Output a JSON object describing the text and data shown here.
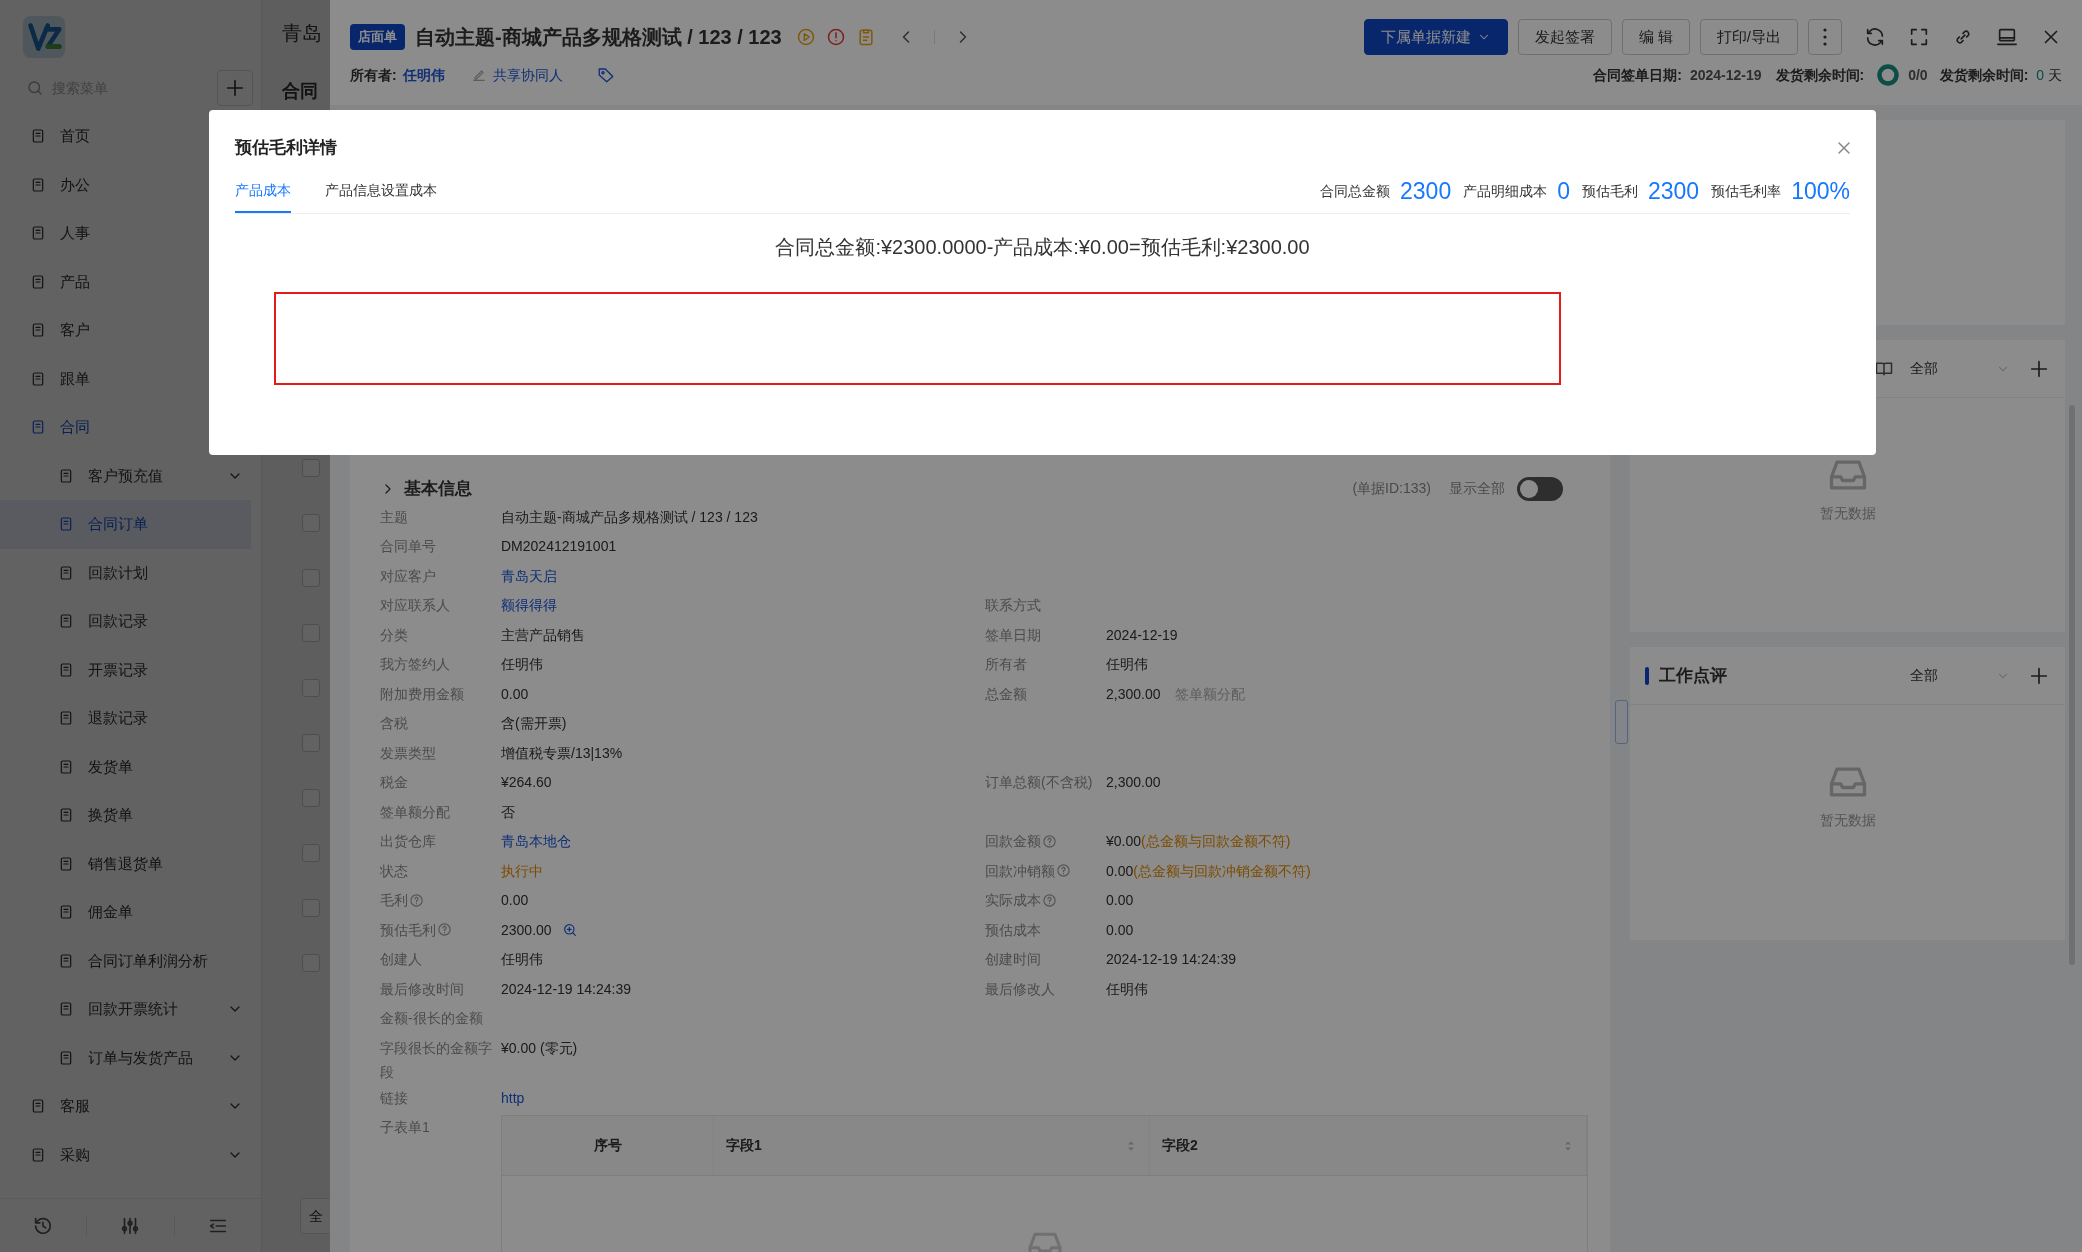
{
  "sidebar": {
    "search": {
      "placeholder": "搜索菜单"
    },
    "items": [
      {
        "label": "首页",
        "selected": false
      },
      {
        "label": "办公",
        "selected": false
      },
      {
        "label": "人事",
        "selected": false
      },
      {
        "label": "产品",
        "selected": false
      },
      {
        "label": "客户",
        "selected": false
      },
      {
        "label": "跟单",
        "selected": false
      },
      {
        "label": "合同",
        "selected": true,
        "collapsible": false,
        "children": [
          {
            "label": "客户预充值",
            "selected": false,
            "collapsible": true
          },
          {
            "label": "合同订单",
            "selected": true,
            "collapsible": false
          },
          {
            "label": "回款计划",
            "selected": false,
            "collapsible": false
          },
          {
            "label": "回款记录",
            "selected": false,
            "collapsible": false
          },
          {
            "label": "开票记录",
            "selected": false,
            "collapsible": false
          },
          {
            "label": "退款记录",
            "selected": false,
            "collapsible": false
          },
          {
            "label": "发货单",
            "selected": false,
            "collapsible": false
          },
          {
            "label": "换货单",
            "selected": false,
            "collapsible": false
          },
          {
            "label": "销售退货单",
            "selected": false,
            "collapsible": false
          },
          {
            "label": "佣金单",
            "selected": false,
            "collapsible": false
          },
          {
            "label": "合同订单利润分析",
            "selected": false,
            "collapsible": false
          },
          {
            "label": "回款开票统计",
            "selected": false,
            "collapsible": true
          },
          {
            "label": "订单与发货产品",
            "selected": false,
            "collapsible": true
          }
        ]
      },
      {
        "label": "客服",
        "selected": false,
        "collapsible": true
      },
      {
        "label": "采购",
        "selected": false,
        "collapsible": true
      }
    ]
  },
  "list_page": {
    "title": "青岛",
    "heading": "合同",
    "rows": [
      {
        "checked": false
      },
      {
        "checked": false
      },
      {
        "checked": false
      },
      {
        "checked": false
      },
      {
        "checked": false
      },
      {
        "checked": false
      },
      {
        "checked": false
      },
      {
        "checked": false
      },
      {
        "checked": false
      },
      {
        "checked": false
      }
    ],
    "footer_button": "全"
  },
  "drawer": {
    "header": {
      "tag": "店面单",
      "title": "自动主题-商城产品多规格测试 / 123 / 123",
      "owner_label": "所有者:",
      "owner": "任明伟",
      "share": "共享协同人",
      "buttons": [
        {
          "label": "下属单据新建",
          "kind": "primary"
        },
        {
          "label": "发起签署",
          "kind": "default"
        },
        {
          "label": "编 辑",
          "kind": "default"
        },
        {
          "label": "打印/导出",
          "kind": "default"
        }
      ],
      "meta": {
        "sign_date_label": "合同签单日期:",
        "sign_date": "2024-12-19",
        "remain_label": "发货剩余时间:",
        "progress": "0/0",
        "remain_label_2": "发货剩余时间:",
        "days": "0",
        "days_unit": "天"
      }
    },
    "basic_info": {
      "title": "基本信息",
      "doc_id": "(单据ID:133)",
      "show_all": {
        "label": "显示全部",
        "on": false
      },
      "rows": [
        {
          "left": {
            "label": "主题",
            "value": "自动主题-商城产品多规格测试 / 123 / 123",
            "kind": "text"
          }
        },
        {
          "left": {
            "label": "合同单号",
            "value": "DM202412191001",
            "kind": "text"
          }
        },
        {
          "left": {
            "label": "对应客户",
            "value": "青岛天启",
            "kind": "link"
          }
        },
        {
          "left": {
            "label": "对应联系人",
            "value": "额得得得",
            "kind": "link"
          },
          "right": {
            "label": "联系方式"
          }
        },
        {
          "left": {
            "label": "分类",
            "value": "主营产品销售",
            "kind": "text"
          },
          "right": {
            "label": "签单日期",
            "value": "2024-12-19",
            "kind": "text"
          }
        },
        {
          "left": {
            "label": "我方签约人",
            "value": "任明伟",
            "kind": "text"
          },
          "right": {
            "label": "所有者",
            "value": "任明伟",
            "kind": "text"
          }
        },
        {
          "left": {
            "label": "附加费用金额",
            "value": "0.00",
            "kind": "text"
          },
          "right": {
            "label": "总金额",
            "value": "2,300.00",
            "kind": "text",
            "note": "签单额分配"
          }
        },
        {
          "left": {
            "label": "含税",
            "value": "含(需开票)",
            "kind": "text"
          }
        },
        {
          "left": {
            "label": "发票类型",
            "value": "增值税专票/13|13%",
            "kind": "text"
          }
        },
        {
          "left": {
            "label": "税金",
            "value": "¥264.60",
            "kind": "text"
          },
          "right": {
            "label": "订单总额(不含税)",
            "value": "2,300.00",
            "kind": "text"
          }
        },
        {
          "left": {
            "label": "签单额分配",
            "value": "否",
            "kind": "text"
          }
        },
        {
          "left": {
            "label": "出货仓库",
            "value": "青岛本地仓",
            "kind": "link"
          },
          "right": {
            "label": "回款金额",
            "help": true,
            "value": "¥0.00",
            "kind": "text",
            "warning": "(总金额与回款金额不符)"
          }
        },
        {
          "left": {
            "label": "状态",
            "value": "执行中",
            "kind": "status"
          },
          "right": {
            "label": "回款冲销额",
            "help": true,
            "value": "0.00",
            "kind": "text",
            "warning": "(总金额与回款冲销金额不符)"
          }
        },
        {
          "left": {
            "label": "毛利",
            "help": true,
            "value": "0.00",
            "kind": "text"
          },
          "right": {
            "label": "实际成本",
            "help": true,
            "value": "0.00",
            "kind": "text"
          }
        },
        {
          "left": {
            "label": "预估毛利",
            "help": true,
            "value": "2300.00",
            "kind": "text",
            "zoom": true
          },
          "right": {
            "label": "预估成本",
            "value": "0.00",
            "kind": "text"
          }
        },
        {
          "left": {
            "label": "创建人",
            "value": "任明伟",
            "kind": "text"
          },
          "right": {
            "label": "创建时间",
            "value": "2024-12-19 14:24:39",
            "kind": "text"
          }
        },
        {
          "left": {
            "label": "最后修改时间",
            "value": "2024-12-19 14:24:39",
            "kind": "text"
          },
          "right": {
            "label": "最后修改人",
            "value": "任明伟",
            "kind": "text"
          }
        },
        {
          "left": {
            "label": "金额-很长的金额"
          }
        },
        {
          "left": {
            "label": "字段很长的金额字段",
            "value": "¥0.00 (零元)",
            "kind": "text"
          }
        },
        {
          "left": {
            "label": "链接",
            "value": "http",
            "kind": "link"
          }
        }
      ],
      "subform": {
        "label": "子表单1",
        "columns": [
          {
            "label": "序号",
            "sortable": false
          },
          {
            "label": "字段1",
            "sortable": true
          },
          {
            "label": "字段2",
            "sortable": true
          }
        ]
      }
    },
    "side_cards": [
      {
        "filter": "全部",
        "empty_text": "暂无数据"
      },
      {
        "title": "工作点评",
        "filter": "全部",
        "empty_text": "暂无数据"
      }
    ]
  },
  "modal": {
    "title": "预估毛利详情",
    "tabs": [
      {
        "label": "产品成本",
        "selected": true
      },
      {
        "label": "产品信息设置成本",
        "selected": false
      }
    ],
    "summary": [
      {
        "label": "合同总金额",
        "value": "2300"
      },
      {
        "label": "产品明细成本",
        "value": "0"
      },
      {
        "label": "预估毛利",
        "value": "2300"
      },
      {
        "label": "预估毛利率",
        "value": "100%"
      }
    ],
    "formula": "合同总金额:¥2300.0000-产品成本:¥0.00=预估毛利:¥2300.00"
  }
}
